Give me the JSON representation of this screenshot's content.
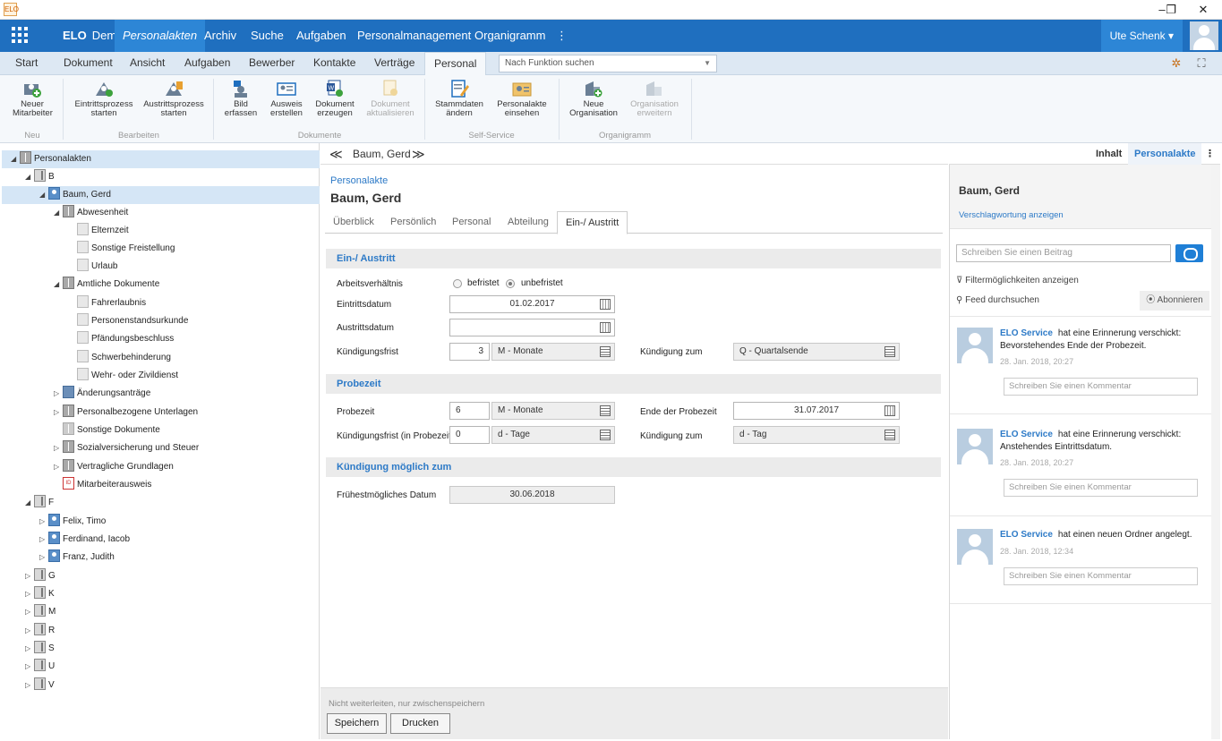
{
  "window": {
    "minimize": "–",
    "restore": "❐",
    "close": "✕"
  },
  "nav": {
    "brand_bold": "ELO",
    "brand_rest": "Demo",
    "items": [
      "Personalakten",
      "Archiv",
      "Suche",
      "Aufgaben",
      "Personalmanagement",
      "Organigramm",
      "⋮"
    ],
    "user": "Ute Schenk ▾"
  },
  "ribbon_tabs": [
    "Start",
    "Dokument",
    "Ansicht",
    "Aufgaben",
    "Bewerber",
    "Kontakte",
    "Verträge",
    "Personal"
  ],
  "function_search": {
    "placeholder": "Nach Funktion suchen",
    "caret": "▼"
  },
  "ribbon": {
    "buttons": [
      {
        "l1": "Neuer",
        "l2": "Mitarbeiter"
      },
      {
        "l1": "Eintrittsprozess",
        "l2": "starten"
      },
      {
        "l1": "Austrittsprozess",
        "l2": "starten"
      },
      {
        "l1": "Bild",
        "l2": "erfassen"
      },
      {
        "l1": "Ausweis",
        "l2": "erstellen"
      },
      {
        "l1": "Dokument",
        "l2": "erzeugen"
      },
      {
        "l1": "Dokument",
        "l2": "aktualisieren"
      },
      {
        "l1": "Stammdaten",
        "l2": "ändern"
      },
      {
        "l1": "Personalakte",
        "l2": "einsehen"
      },
      {
        "l1": "Neue",
        "l2": "Organisation"
      },
      {
        "l1": "Organisation",
        "l2": "erweitern"
      }
    ],
    "groups": [
      "Neu",
      "Bearbeiten",
      "Dokumente",
      "Self-Service",
      "Organigramm"
    ]
  },
  "tree": {
    "items": [
      {
        "label": "Personalakten",
        "tog": "◢"
      },
      {
        "label": "B",
        "tog": "◢"
      },
      {
        "label": "Baum, Gerd",
        "tog": "◢"
      },
      {
        "label": "Abwesenheit",
        "tog": "◢"
      },
      {
        "label": "Elternzeit",
        "tog": ""
      },
      {
        "label": "Sonstige Freistellung",
        "tog": ""
      },
      {
        "label": "Urlaub",
        "tog": ""
      },
      {
        "label": "Amtliche Dokumente",
        "tog": "◢"
      },
      {
        "label": "Fahrerlaubnis",
        "tog": ""
      },
      {
        "label": "Personenstandsurkunde",
        "tog": ""
      },
      {
        "label": "Pfändungsbeschluss",
        "tog": ""
      },
      {
        "label": "Schwerbehinderung",
        "tog": ""
      },
      {
        "label": "Wehr- oder Zivildienst",
        "tog": ""
      },
      {
        "label": "Änderungsanträge",
        "tog": "▷"
      },
      {
        "label": "Personalbezogene Unterlagen",
        "tog": "▷"
      },
      {
        "label": "Sonstige Dokumente",
        "tog": ""
      },
      {
        "label": "Sozialversicherung und Steuer",
        "tog": "▷"
      },
      {
        "label": "Vertragliche Grundlagen",
        "tog": "▷"
      },
      {
        "label": "Mitarbeiterausweis",
        "tog": ""
      },
      {
        "label": "F",
        "tog": "◢"
      },
      {
        "label": "Felix, Timo",
        "tog": "▷"
      },
      {
        "label": "Ferdinand, Iacob",
        "tog": "▷"
      },
      {
        "label": "Franz, Judith",
        "tog": "▷"
      },
      {
        "label": "G",
        "tog": "▷"
      },
      {
        "label": "K",
        "tog": "▷"
      },
      {
        "label": "M",
        "tog": "▷"
      },
      {
        "label": "R",
        "tog": "▷"
      },
      {
        "label": "S",
        "tog": "▷"
      },
      {
        "label": "U",
        "tog": "▷"
      },
      {
        "label": "V",
        "tog": "▷"
      }
    ],
    "card_text": "ID"
  },
  "breadcrumb": {
    "back": "≪",
    "forward": "≫",
    "label": "Baum, Gerd"
  },
  "record": {
    "type": "Personalakte",
    "name": "Baum, Gerd"
  },
  "tabs": [
    "Überblick",
    "Persönlich",
    "Personal",
    "Abteilung",
    "Ein-/ Austritt"
  ],
  "form": {
    "sec1": "Ein-/ Austritt",
    "arbeitsverhaeltnis_label": "Arbeitsverhältnis",
    "befristet": "befristet",
    "unbefristet": "unbefristet",
    "eintrittsdatum_label": "Eintrittsdatum",
    "eintrittsdatum": "01.02.2017",
    "austrittsdatum_label": "Austrittsdatum",
    "austrittsdatum": "",
    "kuendigungsfrist_label": "Kündigungsfrist",
    "kuendigungsfrist_num": "3",
    "kuendigungsfrist_unit": "M - Monate",
    "kuendigung_zum_label": "Kündigung zum",
    "kuendigung_zum": "Q - Quartalsende",
    "sec2": "Probezeit",
    "probezeit_label": "Probezeit",
    "probezeit_num": "6",
    "probezeit_unit": "M - Monate",
    "ende_probezeit_label": "Ende der Probezeit",
    "ende_probezeit": "31.07.2017",
    "kf_probezeit_label": "Kündigungsfrist (in Probezeit)",
    "kf_probezeit_num": "0",
    "kf_probezeit_unit": "d - Tage",
    "kuendigung_zum2_label": "Kündigung zum",
    "kuendigung_zum2": "d - Tag",
    "sec3": "Kündigung möglich zum",
    "fruehestes_label": "Frühestmögliches Datum",
    "fruehestes": "30.06.2018"
  },
  "footer": {
    "note": "Nicht weiterleiten, nur zwischenspeichern",
    "save": "Speichern",
    "print": "Drucken"
  },
  "right": {
    "tab_inhalt": "Inhalt",
    "tab_personalakte": "Personalakte",
    "tab_more": "⋮",
    "name": "Baum, Gerd",
    "verschlagwortung": "Verschlagwortung anzeigen",
    "post_placeholder": "Schreiben Sie einen Beitrag",
    "filter": "Filtermöglichkeiten anzeigen",
    "feed_search": "Feed durchsuchen",
    "abonnieren": "Abonnieren",
    "feed": [
      {
        "who": "ELO Service",
        "text": "hat eine Erinnerung verschickt: Bevorstehendes Ende der Probezeit.",
        "ts": "28. Jan. 2018, 20:27",
        "comment": "Schreiben Sie einen Kommentar"
      },
      {
        "who": "ELO Service",
        "text": "hat eine Erinnerung verschickt: Anstehendes Eintrittsdatum.",
        "ts": "28. Jan. 2018, 20:27",
        "comment": "Schreiben Sie einen Kommentar"
      },
      {
        "who": "ELO Service",
        "text": "hat einen neuen Ordner angelegt.",
        "ts": "28. Jan. 2018, 12:34",
        "comment": "Schreiben Sie einen Kommentar"
      }
    ]
  }
}
